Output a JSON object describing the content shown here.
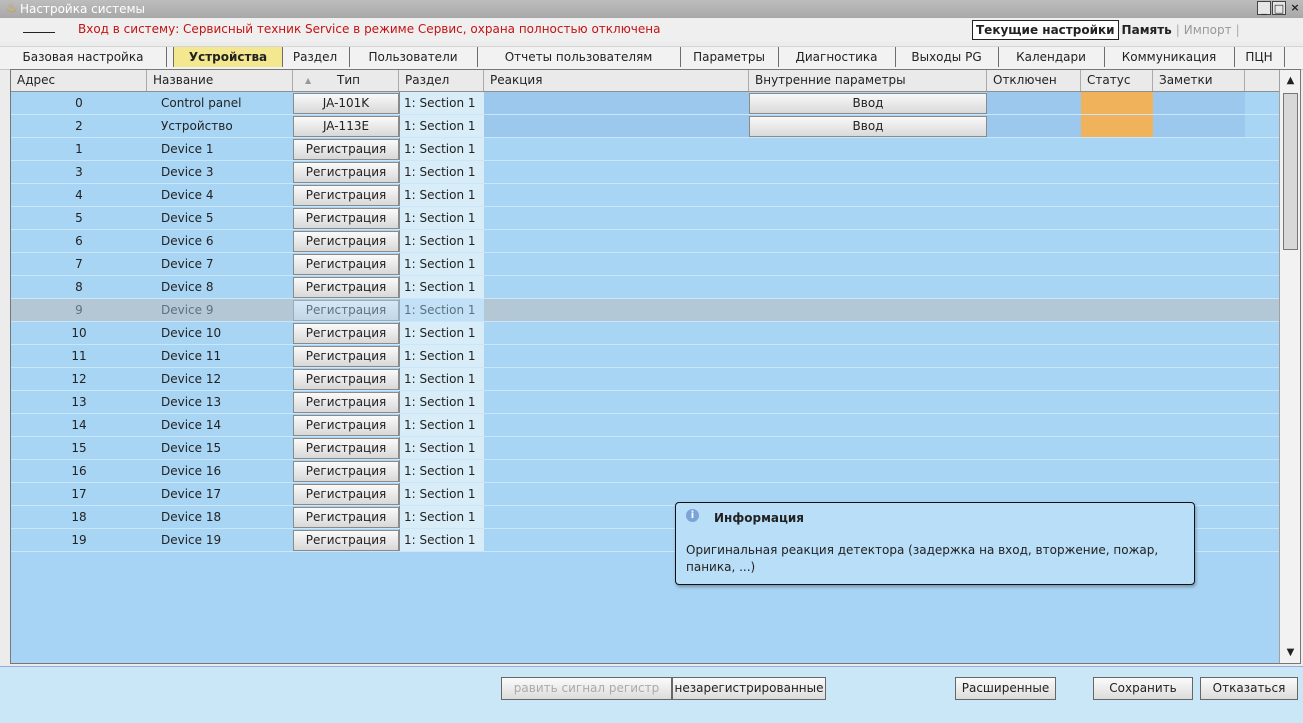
{
  "window": {
    "title": "Настройка системы"
  },
  "login": "Вход в систему: Сервисный техник Service в режиме Сервис, охрана полностью отключена",
  "modes": [
    "Текущие настройки",
    "Память",
    "Импорт"
  ],
  "tabs": [
    "Базовая настройка",
    "Устройства",
    "Раздел",
    "Пользователи",
    "Отчеты пользователям",
    "Параметры",
    "Диагностика",
    "Выходы PG",
    "Календари",
    "Коммуникация",
    "ПЦН"
  ],
  "columns": [
    "Адрес",
    "Название",
    "Тип",
    "Раздел",
    "Реакция",
    "Внутренние параметры",
    "Отключен",
    "Статус",
    "Заметки"
  ],
  "rows": [
    {
      "address": "0",
      "name": "Control panel",
      "type": "JA-101K",
      "section": "1: Section 1",
      "params": "Ввод",
      "status": true
    },
    {
      "address": "2",
      "name": "Устройство",
      "type": "JA-113E",
      "section": "1: Section 1",
      "params": "Ввод",
      "status": true
    },
    {
      "address": "1",
      "name": "Device 1",
      "type": "Регистрация",
      "section": "1: Section 1"
    },
    {
      "address": "3",
      "name": "Device 3",
      "type": "Регистрация",
      "section": "1: Section 1"
    },
    {
      "address": "4",
      "name": "Device 4",
      "type": "Регистрация",
      "section": "1: Section 1"
    },
    {
      "address": "5",
      "name": "Device 5",
      "type": "Регистрация",
      "section": "1: Section 1"
    },
    {
      "address": "6",
      "name": "Device 6",
      "type": "Регистрация",
      "section": "1: Section 1"
    },
    {
      "address": "7",
      "name": "Device 7",
      "type": "Регистрация",
      "section": "1: Section 1"
    },
    {
      "address": "8",
      "name": "Device 8",
      "type": "Регистрация",
      "section": "1: Section 1"
    },
    {
      "address": "9",
      "name": "Device 9",
      "type": "Регистрация",
      "section": "1: Section 1",
      "disabled": true
    },
    {
      "address": "10",
      "name": "Device 10",
      "type": "Регистрация",
      "section": "1: Section 1"
    },
    {
      "address": "11",
      "name": "Device 11",
      "type": "Регистрация",
      "section": "1: Section 1"
    },
    {
      "address": "12",
      "name": "Device 12",
      "type": "Регистрация",
      "section": "1: Section 1"
    },
    {
      "address": "13",
      "name": "Device 13",
      "type": "Регистрация",
      "section": "1: Section 1"
    },
    {
      "address": "14",
      "name": "Device 14",
      "type": "Регистрация",
      "section": "1: Section 1"
    },
    {
      "address": "15",
      "name": "Device 15",
      "type": "Регистрация",
      "section": "1: Section 1"
    },
    {
      "address": "16",
      "name": "Device 16",
      "type": "Регистрация",
      "section": "1: Section 1"
    },
    {
      "address": "17",
      "name": "Device 17",
      "type": "Регистрация",
      "section": "1: Section 1"
    },
    {
      "address": "18",
      "name": "Device 18",
      "type": "Регистрация",
      "section": "1: Section 1"
    },
    {
      "address": "19",
      "name": "Device 19",
      "type": "Регистрация",
      "section": "1: Section 1"
    }
  ],
  "tooltip": {
    "title": "Информация",
    "text": "Оригинальная реакция детектора (задержка на вход, вторжение, пожар, паника, ...)"
  },
  "footer": {
    "register_signal": "равить сигнал регистр",
    "unregistered": "незарегистрированные",
    "advanced": "Расширенные",
    "save": "Сохранить",
    "cancel": "Отказаться"
  },
  "colors": {
    "accent": "#f3e78f",
    "grid": "#a9d5f5",
    "status": "#f0b35c"
  },
  "icons": {
    "app": "fire-icon",
    "info": "info-icon",
    "sort": "sort-up-icon",
    "scroll_up": "chevron-up-icon",
    "scroll_down": "chevron-down-icon"
  }
}
